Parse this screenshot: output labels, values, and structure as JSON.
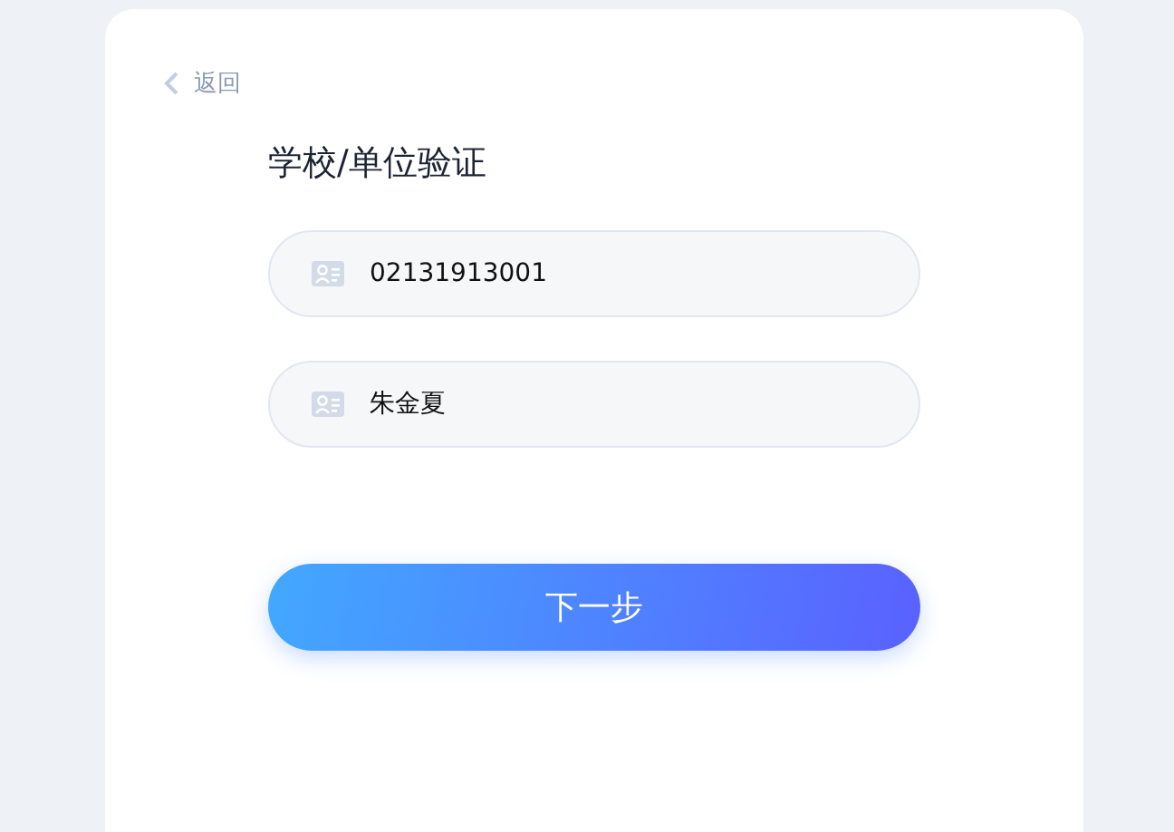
{
  "back": {
    "label": "返回"
  },
  "title": "学校/单位验证",
  "fields": [
    {
      "value": "02131913001"
    },
    {
      "value": "朱金夏"
    }
  ],
  "button": {
    "label": "下一步"
  }
}
